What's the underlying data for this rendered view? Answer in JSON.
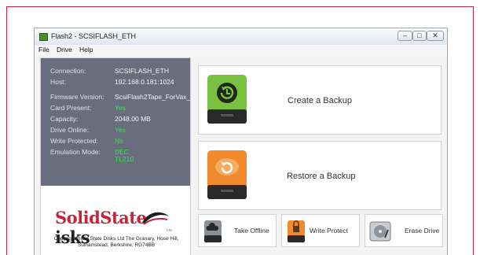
{
  "window": {
    "title": "Flash2 - SCSIFLASH_ETH"
  },
  "menu": [
    "File",
    "Drive",
    "Help"
  ],
  "info": [
    {
      "label": "Connection:",
      "value": "SCSIFLASH_ETH"
    },
    {
      "label": "Host:",
      "value": "192.168.0.181:1024"
    },
    {
      "label": "Firmware Version:",
      "value": "ScsiFlash2Tape_ForVax_"
    },
    {
      "label": "Card Present:",
      "value": "Yes"
    },
    {
      "label": "Capacity:",
      "value": "2048.00 MB"
    },
    {
      "label": "Drive Online:",
      "value": "Yes"
    },
    {
      "label": "Write Protected:",
      "value": "No"
    },
    {
      "label": "Emulation Mode:",
      "value": "DEC",
      "value2": "TL210"
    }
  ],
  "logo": {
    "part1": "SolidState",
    "part2": "isks",
    "ltd": "LTD"
  },
  "copyright": "Copyright Solid State Disks Ltd The Granary, Hose Hill, Sulhamstead, Berkshire, RG74BB",
  "actions": {
    "create_backup": "Create a Backup",
    "restore_backup": "Restore a Backup",
    "take_offline": "Take Offline",
    "write_protect": "Write Protect",
    "erase_drive": "Erase Drive"
  },
  "colors": {
    "accent_red": "#c3263b",
    "status_green": "#39e34a",
    "panel_grey": "#686e7d",
    "drive_green": "#7ac142",
    "drive_orange": "#f08a2c"
  }
}
